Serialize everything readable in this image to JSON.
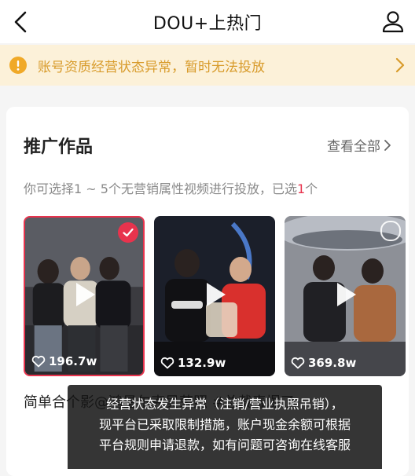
{
  "header": {
    "title": "DOU+上热门"
  },
  "warning": {
    "text": "账号资质经营状态异常，暂时无法投放",
    "color": "#d89b2b",
    "background": "#fcf1d9"
  },
  "works": {
    "title": "推广作品",
    "view_all": "查看全部",
    "desc_prefix": "你可选择1 ~ 5个无营销属性视频进行投放，已选",
    "selected_count": "1",
    "desc_suffix": "个",
    "videos": [
      {
        "likes": "196.7w",
        "selected": true
      },
      {
        "likes": "132.9w",
        "selected": false
      },
      {
        "likes": "369.8w",
        "selected": false
      }
    ],
    "caption": "简单合个影@鸿星尔克吴荣照 #总裁毒爆了"
  },
  "toast": {
    "line1": "经营状态发生异常（注销/营业执照吊销），",
    "line2": "现平台已采取限制措施，账户现金余额可根据",
    "line3": "平台规则申请退款，如有问题可咨询在线客服"
  },
  "colors": {
    "accent": "#e8334d",
    "toast_bg": "#141414"
  },
  "icons": {
    "back": "back-arrow-icon",
    "user": "user-icon",
    "warning": "warning-circle-icon",
    "chevron": "chevron-right-icon",
    "play": "play-icon",
    "heart": "heart-icon",
    "check": "check-icon"
  }
}
